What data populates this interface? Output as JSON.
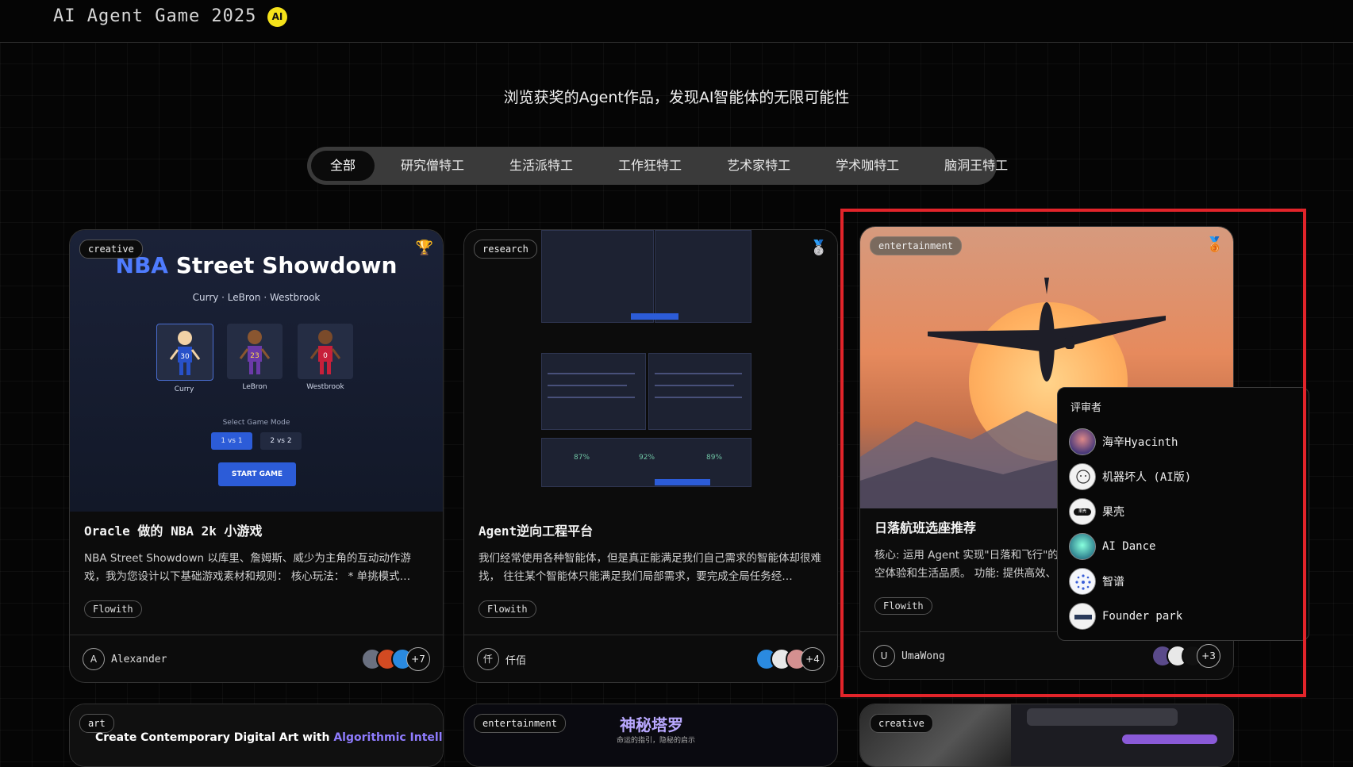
{
  "header": {
    "title": "AI Agent Game 2025",
    "badge": "AI"
  },
  "subtitle": "浏览获奖的Agent作品，发现AI智能体的无限可能性",
  "tabs": [
    {
      "label": "全部",
      "active": true
    },
    {
      "label": "研究僧特工",
      "active": false
    },
    {
      "label": "生活派特工",
      "active": false
    },
    {
      "label": "工作狂特工",
      "active": false
    },
    {
      "label": "艺术家特工",
      "active": false
    },
    {
      "label": "学术咖特工",
      "active": false
    },
    {
      "label": "脑洞王特工",
      "active": false
    }
  ],
  "cards": [
    {
      "tag": "creative",
      "medal": "🏆",
      "title": "Oracle 做的 NBA 2k 小游戏",
      "description": "NBA Street Showdown 以库里、詹姆斯、威少为主角的互动动作游戏，我为您设计以下基础游戏素材和规则： 核心玩法： * 单挑模式…",
      "badge": "Flowith",
      "author_initial": "A",
      "author": "Alexander",
      "more_reviewers": "+7",
      "preview": {
        "title_highlight": "NBA",
        "title_rest": "Street Showdown",
        "subtitle": "Curry · LeBron · Westbrook",
        "players": [
          {
            "name": "Curry",
            "number": "30"
          },
          {
            "name": "LeBron",
            "number": "23"
          },
          {
            "name": "Westbrook",
            "number": "0"
          }
        ],
        "mode_label": "Select Game Mode",
        "mode_1": "1 vs 1",
        "mode_2": "2 vs 2",
        "start": "START GAME"
      }
    },
    {
      "tag": "research",
      "medal": "🥈",
      "title": "Agent逆向工程平台",
      "description": "我们经常使用各种智能体，但是真正能满足我们自己需求的智能体却很难找， 往往某个智能体只能满足我们局部需求，要完成全局任务经…",
      "badge": "Flowith",
      "author_initial": "仟",
      "author": "仟佰",
      "more_reviewers": "+4",
      "preview": {
        "stat_1": "87%",
        "stat_2": "92%",
        "stat_3": "89%"
      }
    },
    {
      "tag": "entertainment",
      "medal": "🥉",
      "title": "日落航班选座推荐",
      "description": "核心: 运用 Agent 实现\"日落和飞行\"的空体验和生活品质。 功能: 提供高效、",
      "badge": "Flowith",
      "author_initial": "U",
      "author": "UmaWong",
      "more_reviewers": "+3"
    }
  ],
  "popover": {
    "title": "评审者",
    "reviewers": [
      {
        "name": "海辛Hyacinth"
      },
      {
        "name": "机器坏人 (AI版)"
      },
      {
        "name": "果壳",
        "avatar_label": "果壳"
      },
      {
        "name": "AI Dance"
      },
      {
        "name": "智谱"
      },
      {
        "name": "Founder park"
      }
    ]
  },
  "bottom_cards": [
    {
      "tag": "art",
      "preview_text_1": "Create Contemporary Digital Art with",
      "preview_text_2": "Algorithmic Intelligence"
    },
    {
      "tag": "entertainment",
      "preview_text_1": "神秘塔罗",
      "preview_text_2": "命运的指引，隐秘的启示"
    },
    {
      "tag": "creative"
    }
  ],
  "colors": {
    "accent_blue": "#4f7cff",
    "highlight_red": "#e2242a",
    "badge_yellow": "#f5e21a"
  }
}
